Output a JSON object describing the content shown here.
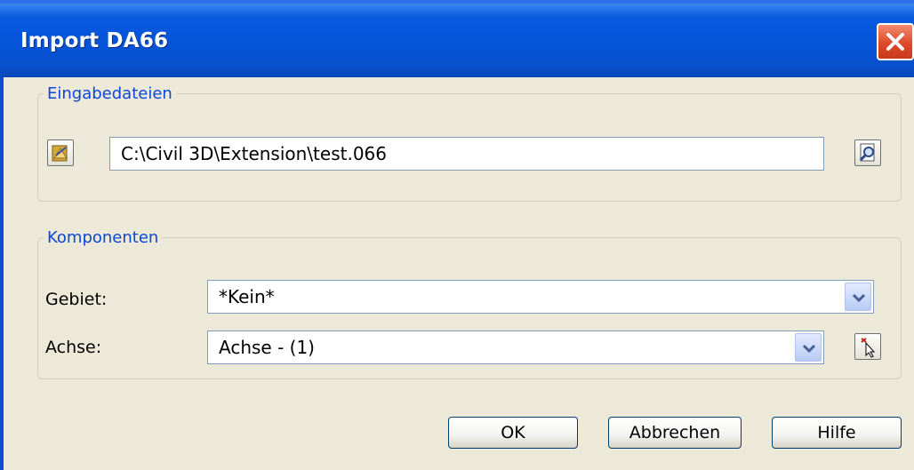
{
  "window": {
    "title": "Import DA66"
  },
  "input_files": {
    "legend": "Eingabedateien",
    "path_value": "C:\\Civil 3D\\Extension\\test.066"
  },
  "components": {
    "legend": "Komponenten",
    "gebiet_label": "Gebiet:",
    "gebiet_value": "*Kein*",
    "achse_label": "Achse:",
    "achse_value": "Achse - (1)"
  },
  "buttons": {
    "ok": "OK",
    "cancel": "Abbrechen",
    "help": "Hilfe"
  },
  "colors": {
    "title_bar": "#0553d6",
    "legend_text": "#0b46d6",
    "dialog_bg": "#ece9d8"
  }
}
